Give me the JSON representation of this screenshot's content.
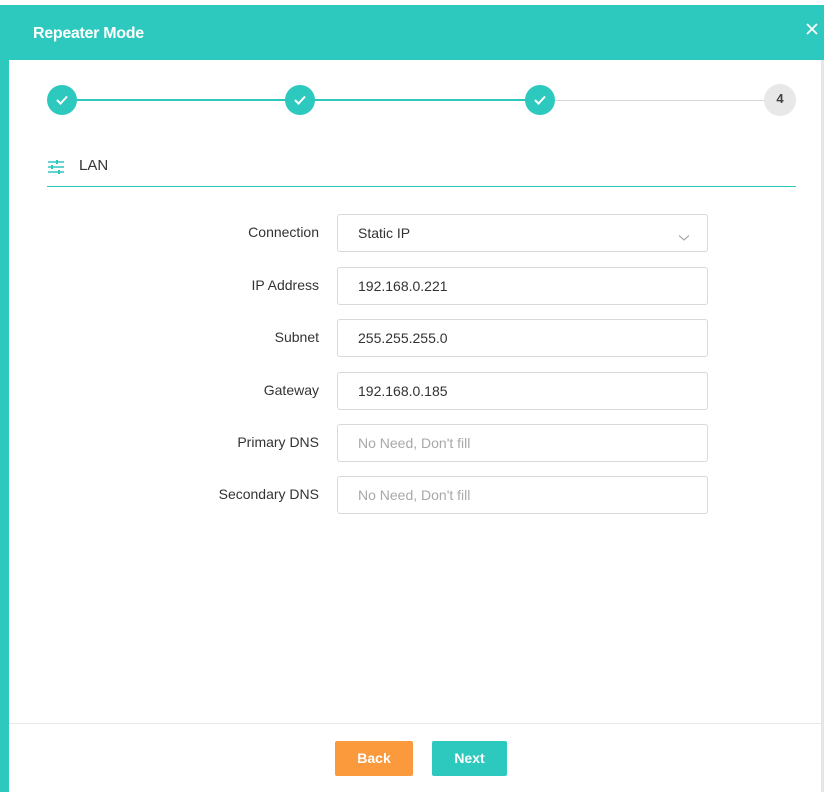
{
  "window": {
    "title": "Repeater Mode",
    "close_icon": "close-icon",
    "accent_color": "#2ec9be"
  },
  "stepper": {
    "steps": [
      {
        "state": "done",
        "icon": "check-icon"
      },
      {
        "state": "done",
        "icon": "check-icon"
      },
      {
        "state": "done",
        "icon": "check-icon"
      },
      {
        "state": "current",
        "label": "4"
      }
    ]
  },
  "section": {
    "icon": "sliders-icon",
    "title": "LAN"
  },
  "form": {
    "connection": {
      "label": "Connection",
      "value": "Static IP"
    },
    "ip_address": {
      "label": "IP Address",
      "value": "192.168.0.221"
    },
    "subnet": {
      "label": "Subnet",
      "value": "255.255.255.0"
    },
    "gateway": {
      "label": "Gateway",
      "value": "192.168.0.185"
    },
    "primary_dns": {
      "label": "Primary DNS",
      "value": "",
      "placeholder": "No Need, Don't fill"
    },
    "secondary_dns": {
      "label": "Secondary DNS",
      "value": "",
      "placeholder": "No Need, Don't fill"
    }
  },
  "footer": {
    "back_label": "Back",
    "next_label": "Next",
    "back_color": "#fb9a3c",
    "next_color": "#2ec9be"
  }
}
